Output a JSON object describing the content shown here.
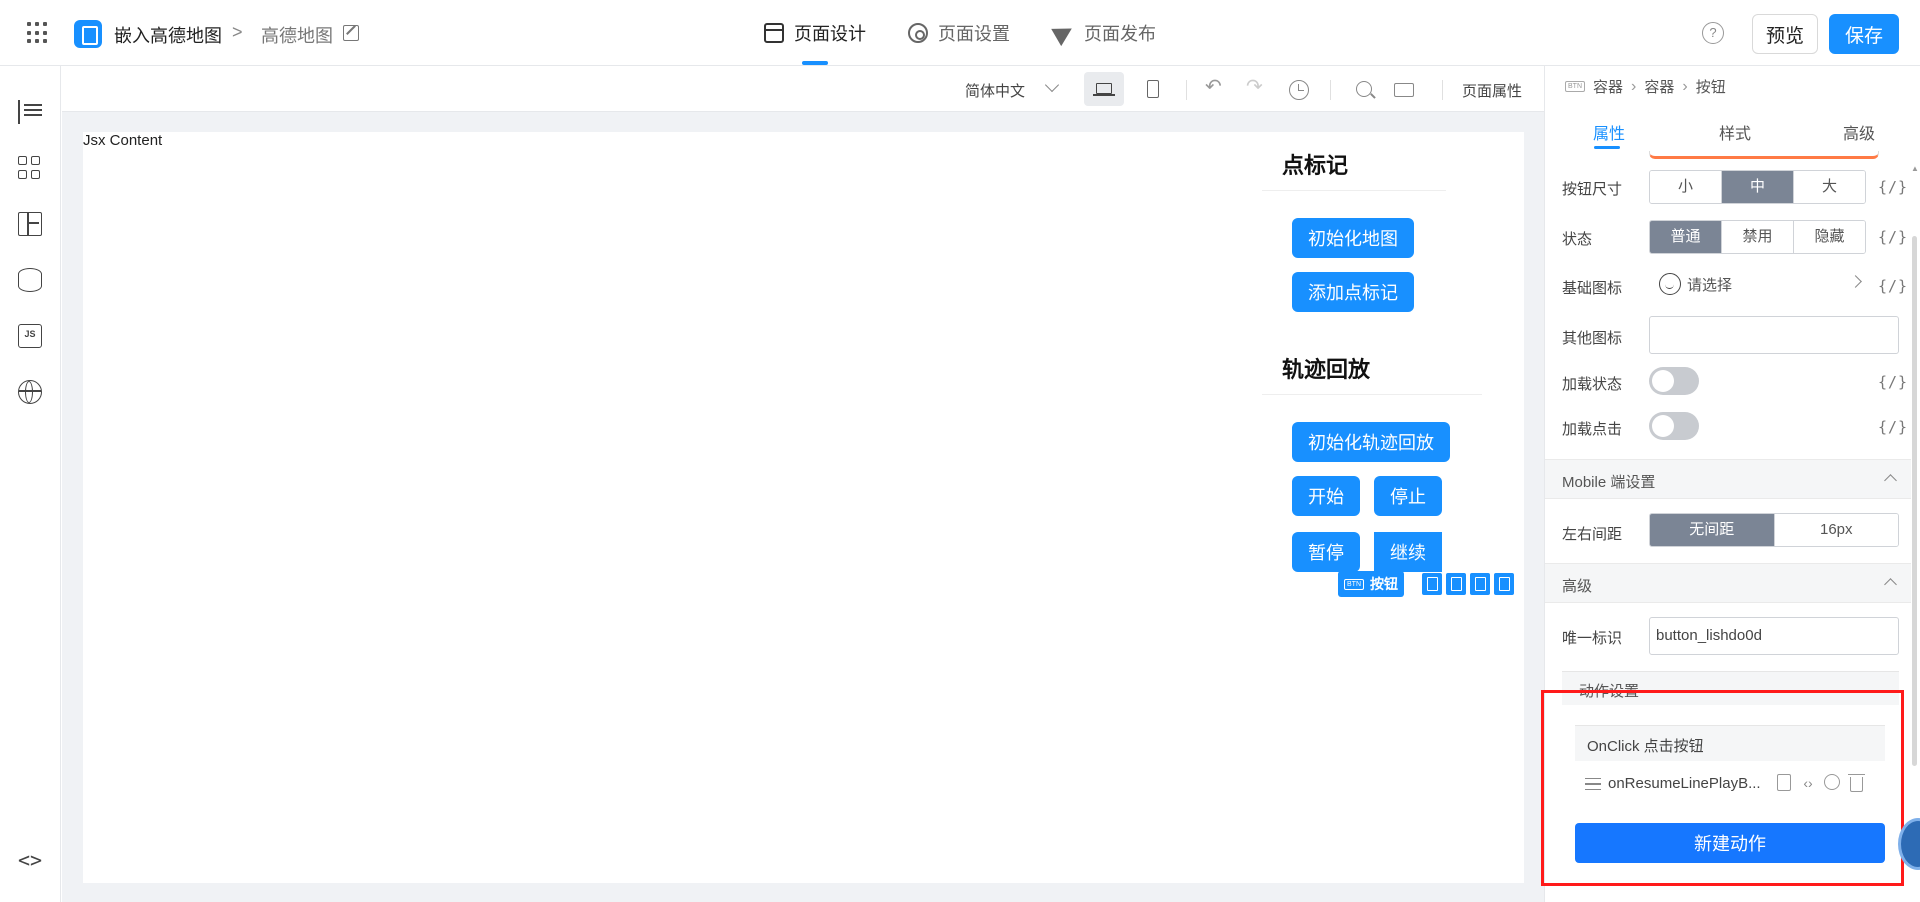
{
  "header": {
    "app_name": "嵌入高德地图",
    "breadcrumb_sep": ">",
    "page_name": "高德地图",
    "tabs": [
      {
        "label": "页面设计",
        "active": true,
        "icon": "window-icon"
      },
      {
        "label": "页面设置",
        "active": false,
        "icon": "gear-icon"
      },
      {
        "label": "页面发布",
        "active": false,
        "icon": "send-icon"
      }
    ],
    "help_glyph": "?",
    "preview_label": "预览",
    "save_label": "保存",
    "accent_color": "#1890ff"
  },
  "sidebar": {
    "items": [
      {
        "icon": "outline-tree-icon"
      },
      {
        "icon": "components-icon"
      },
      {
        "icon": "layout-icon"
      },
      {
        "icon": "data-source-icon"
      },
      {
        "icon": "js-icon",
        "label": "JS"
      },
      {
        "icon": "globe-icon"
      },
      {
        "icon": "code-icon",
        "label": "<>"
      }
    ]
  },
  "toolbar": {
    "language": "简体中文",
    "undo_glyph": "↶",
    "redo_glyph": "↷",
    "page_props": "页面属性"
  },
  "canvas": {
    "jsx_label": "Jsx Content",
    "sections": [
      {
        "title": "点标记",
        "buttons": [
          "初始化地图",
          "添加点标记"
        ]
      },
      {
        "title": "轨迹回放",
        "buttons": [
          "初始化轨迹回放",
          "开始",
          "停止",
          "暂停",
          "继续"
        ]
      }
    ],
    "selection_badge": {
      "tag": "BTN",
      "label": "按钮"
    }
  },
  "right_panel": {
    "breadcrumb": {
      "tag": "BTN",
      "items": [
        "容器",
        "容器",
        "按钮"
      ]
    },
    "tabs": [
      "属性",
      "样式",
      "高级"
    ],
    "active_tab": "属性",
    "expr_glyph": "{/}",
    "button_size": {
      "label": "按钮尺寸",
      "options": [
        "小",
        "中",
        "大"
      ],
      "selected": "中"
    },
    "state": {
      "label": "状态",
      "options": [
        "普通",
        "禁用",
        "隐藏"
      ],
      "selected": "普通"
    },
    "base_icon": {
      "label": "基础图标",
      "placeholder": "请选择"
    },
    "other_icon": {
      "label": "其他图标",
      "value": ""
    },
    "loading_state": {
      "label": "加载状态",
      "on": false
    },
    "loading_click": {
      "label": "加载点击",
      "on": false
    },
    "mobile_section": "Mobile 端设置",
    "lr_spacing": {
      "label": "左右间距",
      "options": [
        "无间距",
        "16px"
      ],
      "selected": "无间距"
    },
    "advanced_section": "高级",
    "unique_id": {
      "label": "唯一标识",
      "value": "button_lishdo0d"
    },
    "action_section": "动作设置",
    "onclick_label": "OnClick 点击按钮",
    "action_item": "onResumeLinePlayB...",
    "new_action_label": "新建动作",
    "highlight_color": "#ff1a1a"
  }
}
